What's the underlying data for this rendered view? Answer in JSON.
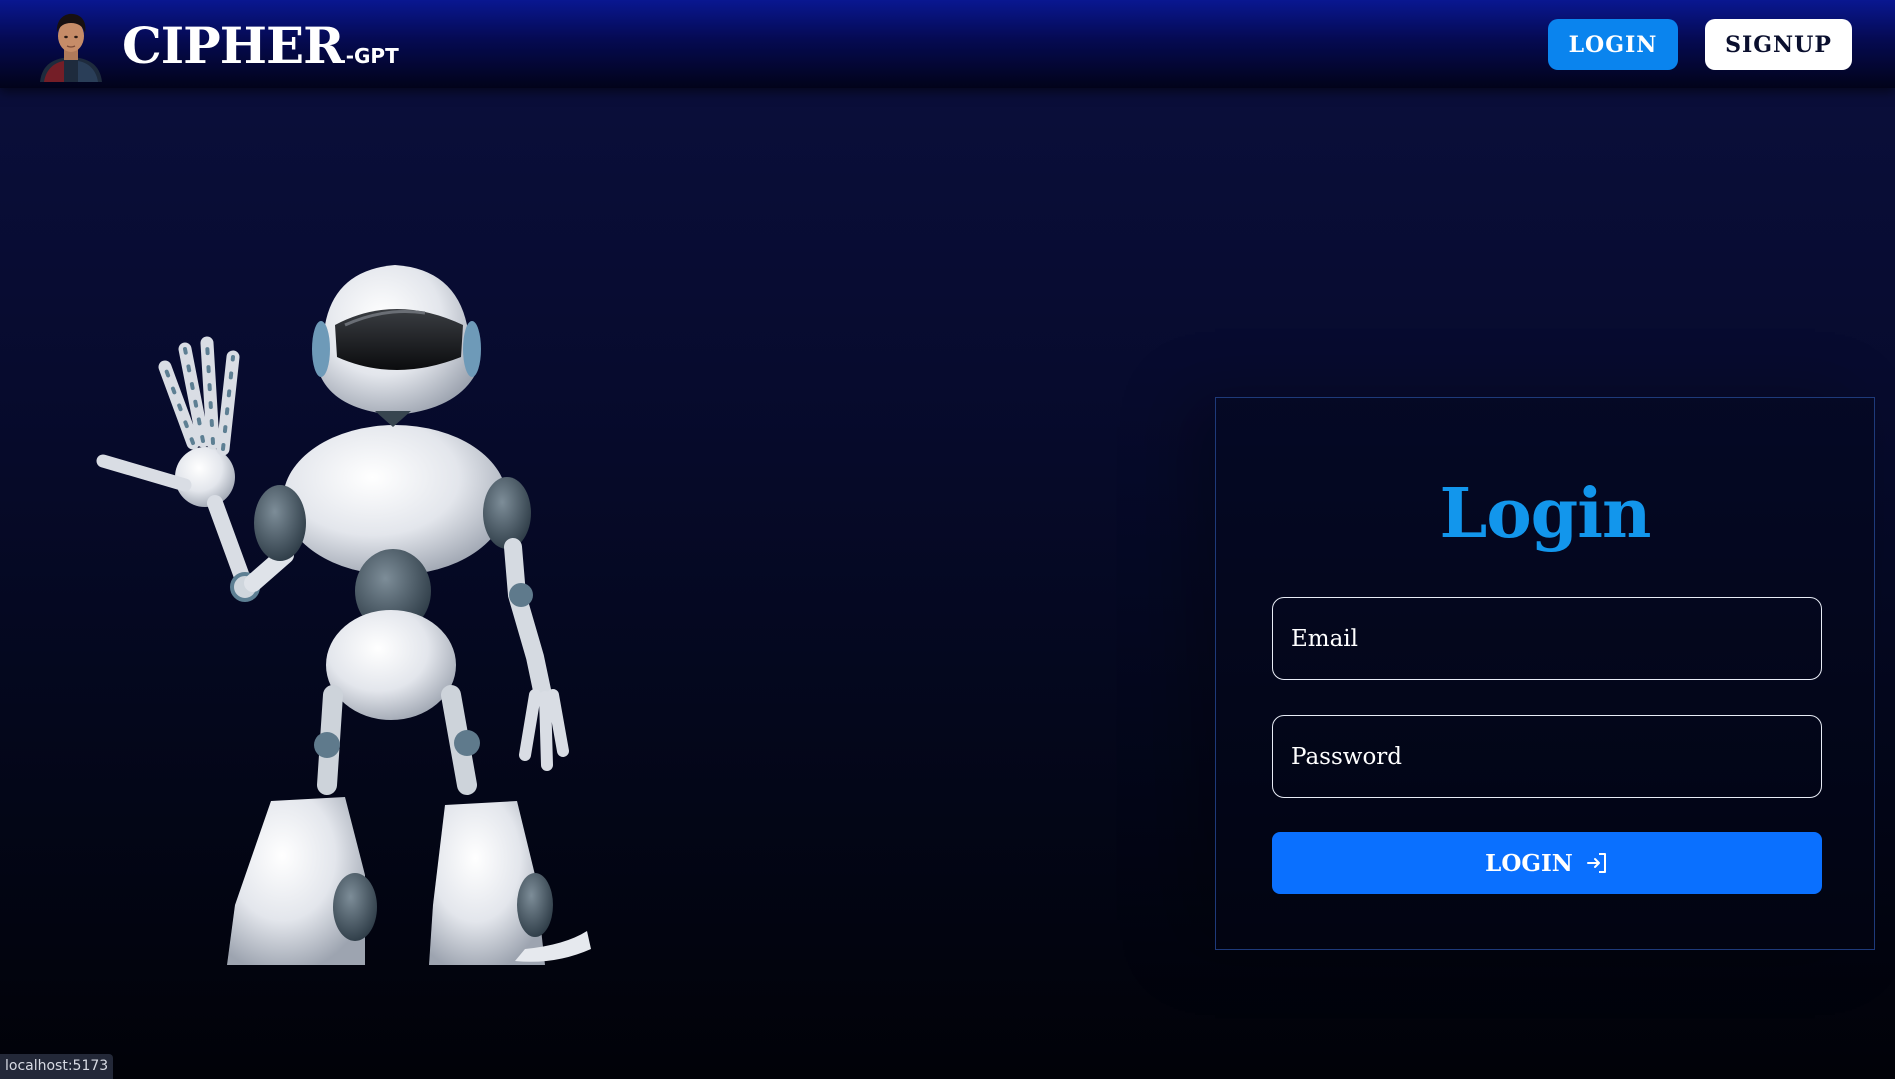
{
  "header": {
    "brand_main": "CIPHER",
    "brand_sub": "-GPT",
    "login_label": "LOGIN",
    "signup_label": "SIGNUP"
  },
  "login_form": {
    "title": "Login",
    "email_placeholder": "Email",
    "password_placeholder": "Password",
    "submit_label": "LOGIN",
    "submit_icon": "login-arrow-icon"
  },
  "status_bar": {
    "url": "localhost:5173"
  },
  "colors": {
    "accent_blue": "#0a84ee",
    "title_blue": "#1296ec",
    "submit_blue": "#0a70ff",
    "navbar_top": "#091791",
    "background_dark": "#030617"
  }
}
